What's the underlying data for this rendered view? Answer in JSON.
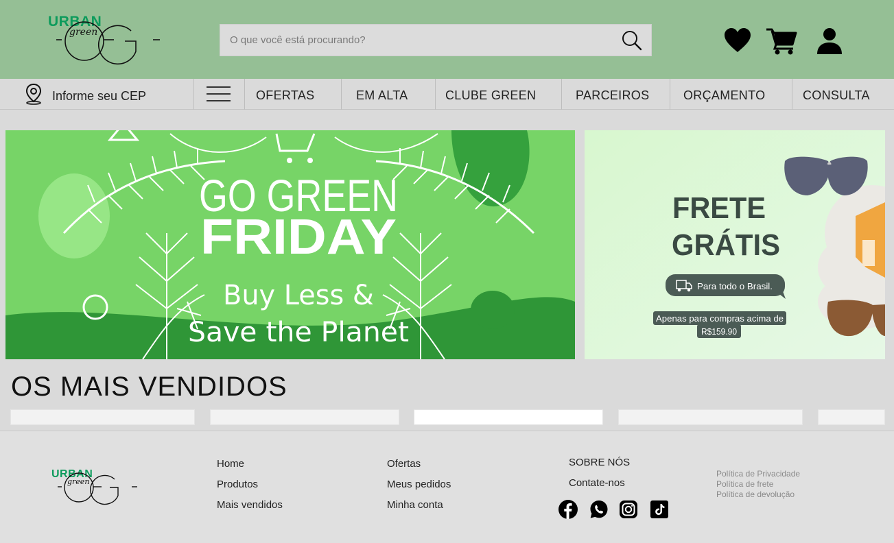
{
  "header": {
    "logo": {
      "brand": "URBAN",
      "sub": "green"
    },
    "search": {
      "placeholder": "O que você está procurando?"
    },
    "icons": [
      "heart-icon",
      "cart-icon",
      "user-icon"
    ]
  },
  "nav": {
    "cep_label": "Informe seu CEP",
    "items": [
      "OFERTAS",
      "EM ALTA",
      "CLUBE GREEN",
      "PARCEIROS",
      "ORÇAMENTO",
      "CONSULTA"
    ]
  },
  "banner_main": {
    "line1": "GO GREEN",
    "line2": "FRIDAY",
    "line3": "Buy Less &",
    "line4": "Save the Planet"
  },
  "banner_side": {
    "line1": "FRETE",
    "line2": "GRÁTIS",
    "pill": "Para todo o Brasil.",
    "note1": "Apenas para compras acima de",
    "note2": "R$159.90"
  },
  "best_sellers": {
    "title": "OS MAIS VENDIDOS"
  },
  "footer": {
    "logo": {
      "brand": "URBAN",
      "sub": "green"
    },
    "col1": [
      "Home",
      "Produtos",
      "Mais vendidos"
    ],
    "col2": [
      "Ofertas",
      "Meus pedidos",
      "Minha conta"
    ],
    "col3": [
      "SOBRE NÓS",
      "Contate-nos"
    ],
    "policies": [
      "Política de Privacidade",
      "Política de frete",
      "Política de devolução"
    ],
    "social": [
      "facebook-icon",
      "whatsapp-icon",
      "instagram-icon",
      "tiktok-icon"
    ]
  },
  "colors": {
    "header_bg": "#95bf95",
    "brand_green": "#0d9b5c",
    "banner_green": "#77d467",
    "banner_dark": "#2f9637",
    "side_bg": "#dcf7d6",
    "side_text": "#3a4a43",
    "page_bg": "#dadada"
  }
}
